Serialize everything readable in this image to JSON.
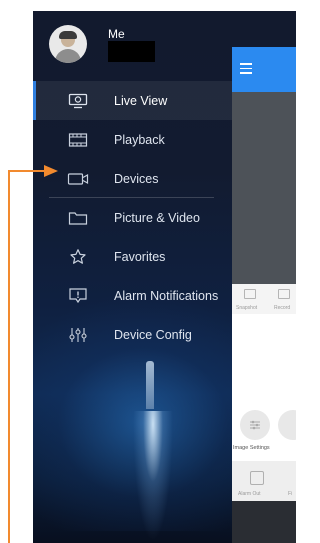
{
  "profile": {
    "name": "Me"
  },
  "menu": {
    "items": [
      {
        "label": "Live View",
        "icon": "live-view-icon",
        "active": true
      },
      {
        "label": "Playback",
        "icon": "film-icon",
        "active": false
      },
      {
        "label": "Devices",
        "icon": "camera-icon",
        "active": false
      },
      {
        "label": "Picture & Video",
        "icon": "folder-icon",
        "active": false
      },
      {
        "label": "Favorites",
        "icon": "star-icon",
        "active": false
      },
      {
        "label": "Alarm Notifications",
        "icon": "alarm-icon",
        "active": false
      },
      {
        "label": "Device Config",
        "icon": "sliders-icon",
        "active": false
      }
    ]
  },
  "preview": {
    "toolbar": [
      "Snapshot",
      "Record"
    ],
    "image_settings_label": "Image Settings",
    "bottom": [
      "Alarm Out",
      "Fi"
    ]
  },
  "colors": {
    "accent": "#2f7fe0",
    "preview_header": "#2b8af0",
    "annotation": "#f28a2e",
    "background_top": "#121a2e"
  }
}
